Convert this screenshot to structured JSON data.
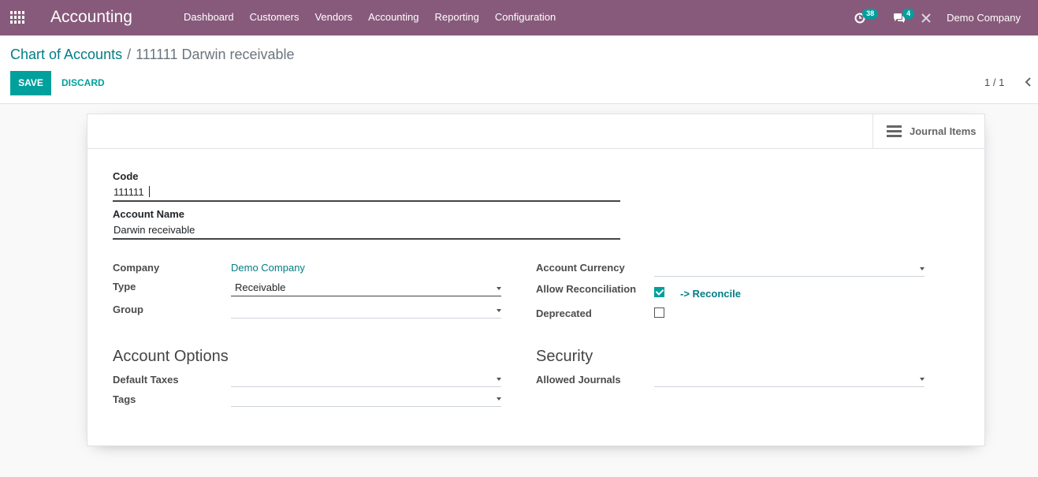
{
  "navbar": {
    "app_title": "Accounting",
    "menu": [
      "Dashboard",
      "Customers",
      "Vendors",
      "Accounting",
      "Reporting",
      "Configuration"
    ],
    "activity_count": "38",
    "message_count": "4",
    "company": "Demo Company",
    "bg_color": "#875a7b"
  },
  "breadcrumb": {
    "parent": "Chart of Accounts",
    "separator": "/",
    "current": "111111 Darwin receivable"
  },
  "actions": {
    "save_label": "SAVE",
    "discard_label": "DISCARD"
  },
  "pager": {
    "value": "1 / 1"
  },
  "button_box": {
    "journal_items_label": "Journal Items"
  },
  "form": {
    "code_label": "Code",
    "code_value": "111111",
    "account_name_label": "Account Name",
    "account_name_value": "Darwin receivable",
    "company_label": "Company",
    "company_value": "Demo Company",
    "type_label": "Type",
    "type_value": "Receivable",
    "group_label": "Group",
    "group_value": "",
    "account_currency_label": "Account Currency",
    "account_currency_value": "",
    "allow_reconciliation_label": "Allow Reconciliation",
    "allow_reconciliation_checked": true,
    "reconcile_link": "-> Reconcile",
    "deprecated_label": "Deprecated",
    "deprecated_checked": false,
    "account_options_title": "Account Options",
    "default_taxes_label": "Default Taxes",
    "tags_label": "Tags",
    "security_title": "Security",
    "allowed_journals_label": "Allowed Journals"
  },
  "colors": {
    "primary": "#00a09d",
    "link": "#017e84"
  }
}
